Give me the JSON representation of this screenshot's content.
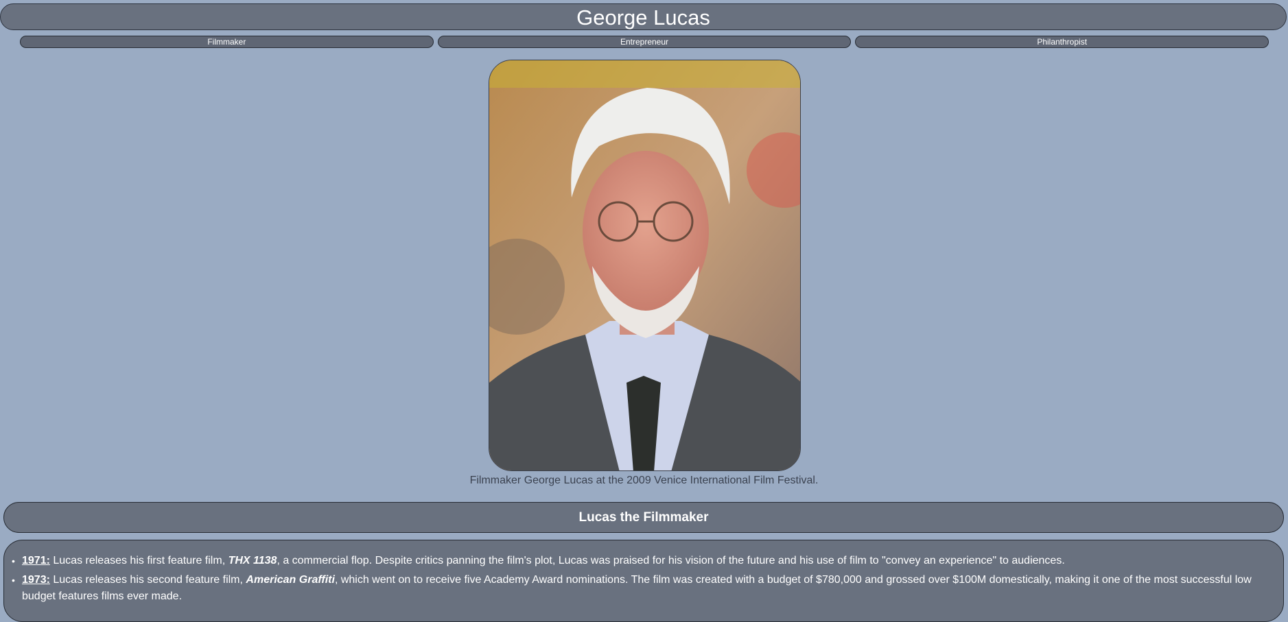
{
  "page": {
    "title": "George Lucas"
  },
  "nav": {
    "items": [
      {
        "label": "Filmmaker"
      },
      {
        "label": "Entrepreneur"
      },
      {
        "label": "Philanthropist"
      }
    ]
  },
  "figure": {
    "caption": "Filmmaker George Lucas at the 2009 Venice International Film Festival."
  },
  "section": {
    "title": "Lucas the Filmmaker",
    "timeline": [
      {
        "year": "1971:",
        "before": " Lucas releases his first feature film, ",
        "film": "THX 1138",
        "after": ", a commercial flop. Despite critics panning the film's plot, Lucas was praised for his vision of the future and his use of film to \"convey an experience\" to audiences."
      },
      {
        "year": "1973:",
        "before": " Lucas releases his second feature film, ",
        "film": "American Graffiti",
        "after": ", which went on to receive five Academy Award nominations. The film was created with a budget of $780,000 and grossed over $100M domestically, making it one of the most successful low budget features films ever made."
      }
    ]
  },
  "colors": {
    "page_background": "#9aabc3",
    "panel": "#69717f",
    "caption_text": "#3b4250"
  }
}
